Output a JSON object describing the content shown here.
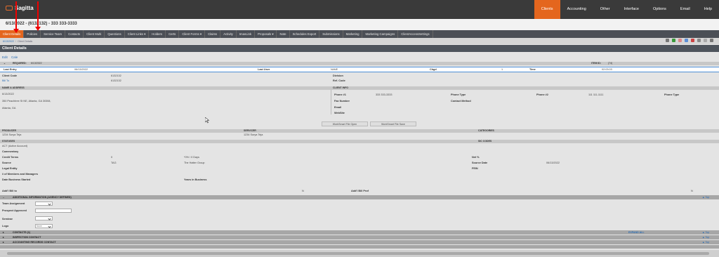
{
  "app": {
    "name": "Sagitta"
  },
  "topnav": {
    "items": [
      "Clients",
      "Accounting",
      "Other",
      "Interface",
      "Options",
      "Email",
      "Help"
    ],
    "active": "Clients"
  },
  "header": {
    "client_title": "6/13/2022 - (6132132) - 333 333-3333"
  },
  "tabs": [
    "Client Details",
    "Policies",
    "Service Team",
    "Contacts",
    "Client Multi",
    "Questions",
    "Client Links ▾",
    "Holders",
    "Certs",
    "Client Forms ▾",
    "Claims",
    "Activity",
    "ImavLink",
    "Proposals ▾",
    "Note",
    "Schedules Export",
    "Submissions",
    "Marketing",
    "Marketing Campaigns",
    "ClientAccessSettings"
  ],
  "active_tab": "Client Details",
  "breadcrumb": {
    "first": "6/13/2022",
    "second": "Client Details"
  },
  "section": {
    "title": "Client Details"
  },
  "links": {
    "edit": "Edit",
    "cale": "Cale"
  },
  "required": {
    "label": "REQUIRED:",
    "value": "6/13/2022",
    "item_id_label": "ITEM ID:",
    "item_id": "(74)"
  },
  "entry_row": {
    "last_entry_label": "Last Entry",
    "last_entry": "06/13/2022",
    "last_user_label": "Last User",
    "last_user": "NAME",
    "chgd_label": "Chgd",
    "chgd": "1",
    "time_label": "Time",
    "time": "02:03:03"
  },
  "client": {
    "code_label": "Client Code",
    "code": "6132132",
    "bill_to_label": "Bill To",
    "bill_to": "6132132",
    "division_label": "Division",
    "ref_code_label": "Ref. Code"
  },
  "name_address": {
    "header": "NAME & ADDRESS",
    "line1": "6/13/2022",
    "line2": "350 Peachtree St NE, Atlanta, GA 30308,",
    "line3": "Atlanta, GA"
  },
  "client_info": {
    "header": "CLIENT INFO",
    "phone1_label": "Phone #1",
    "phone1": "333 333-3333",
    "phone_type_label": "Phone Type",
    "phone2_label": "Phone #2",
    "phone2": "111 111-1111",
    "phone_type2_label": "Phone Type",
    "fax_label": "Fax Number",
    "contact_method_label": "Contact Method",
    "email_label": "Email",
    "website_label": "WebSite"
  },
  "buttons": {
    "file_open": "WorkSmart File Open",
    "file_save": "WorkSmart File Save"
  },
  "producer": {
    "header": "PRODUCER",
    "value": "1234 Surya Teja",
    "servicer_header": "SERVICER",
    "servicer": "1234 Surya Teja",
    "categories_header": "CATEGORIES"
  },
  "statuses": {
    "header": "STATUSES",
    "value": "ACT (Active Account)",
    "sic_header": "SIC CODES"
  },
  "details": {
    "commentary": "Commentary",
    "credit_terms_label": "Credit Terms",
    "credit_terms": "0",
    "pct_days": "*0% / 0 Days",
    "net_label": "Net %",
    "source_label": "Source",
    "source": "TAG",
    "source2": "The Hatter Group",
    "source_date_label": "Source Date",
    "source_date": "06/13/2022",
    "legal_entity": "Legal Entity",
    "fein": "FEIN",
    "members": "# of Members and Managers",
    "date_started": "Date Business Started",
    "years": "Years in Business"
  },
  "addtl": {
    "bill_to": "Add'l Bill to",
    "bill_to_val": "N",
    "prof": "Add'l Bill Prof",
    "prof_val": "N"
  },
  "agency_defined": {
    "header": "ADDITIONAL INFORMATION (AGENCY DEFINED)",
    "top": "▲ Top",
    "team_assignment": "Team Assignment",
    "prospect_approved": "Prospect Approved",
    "seminar": "Seminar",
    "logo": "Logo",
    "logo_value": "None"
  },
  "contacts": [
    {
      "label": "CONTACTS (1)",
      "extra": "EXPAND ALL",
      "top": "▲ Top"
    },
    {
      "label": "INSPECTION CONTACT",
      "top": "▲ Top"
    },
    {
      "label": "ACCOUNTING RECORDS CONTACT",
      "top": "▲ Top"
    }
  ],
  "colors": {
    "accent": "#e4661e",
    "topbar": "#3a3a3a",
    "tabbar": "#4b4f56",
    "link": "#2a6db5",
    "annotation": "#e00000"
  },
  "icons": [
    "logo-icon",
    "toolbar-icons",
    "chevron-down-icon",
    "mouse-cursor-icon",
    "red-arrow-annotation"
  ]
}
